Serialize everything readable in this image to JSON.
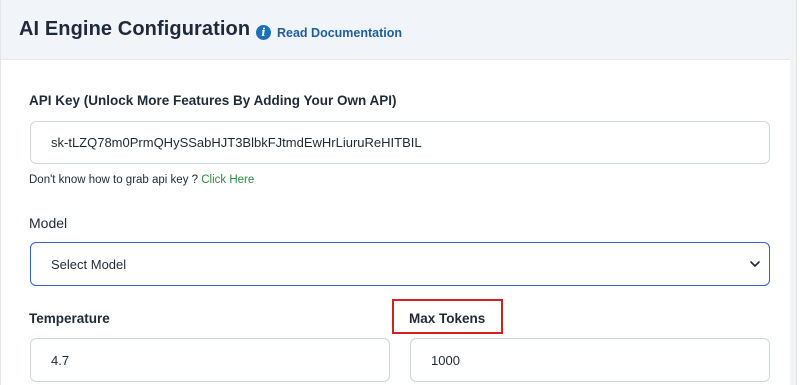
{
  "header": {
    "title": "AI Engine Configuration",
    "doc_icon": "info-icon",
    "doc_link": "Read Documentation"
  },
  "api_key": {
    "label": "API Key (Unlock More Features By Adding Your Own API)",
    "value": "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",
    "helper_text": "Don't know how to grab api key ?",
    "helper_link": "Click Here"
  },
  "model": {
    "label": "Model",
    "selected": "Select Model",
    "chevron_icon": "chevron-down-icon"
  },
  "temperature": {
    "label": "Temperature",
    "value": "4.7"
  },
  "max_tokens": {
    "label": "Max Tokens",
    "value": "1000"
  },
  "colors": {
    "accent": "#1d6fb8",
    "link_green": "#2e8b3e",
    "highlight": "#d61f1f",
    "select_border": "#2f63c4"
  }
}
